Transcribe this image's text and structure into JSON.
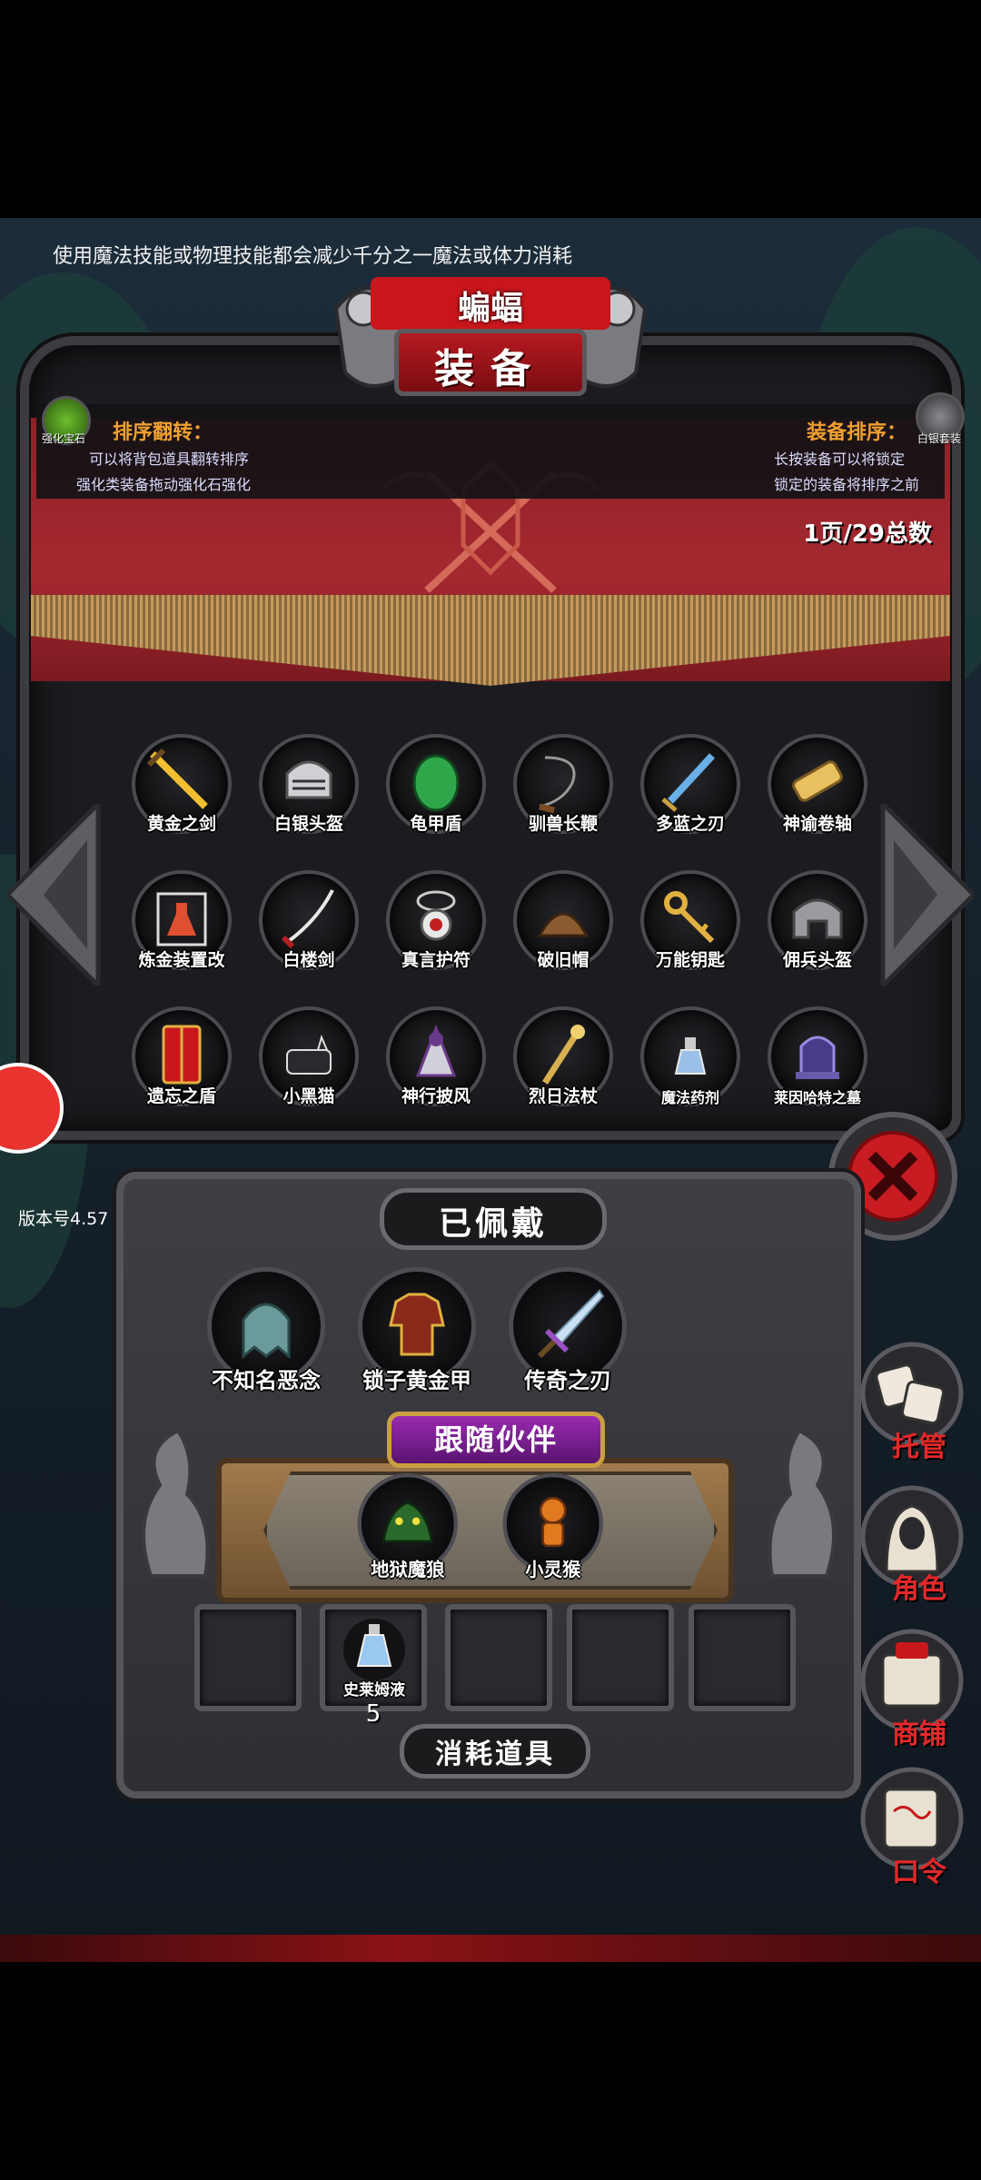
{
  "tip": "使用魔法技能或物理技能都会减少千分之一魔法或体力消耗",
  "header": {
    "nickname": "蝙蝠",
    "title": "装备"
  },
  "info": {
    "left_icon_label": "强化宝石",
    "left_title": "排序翻转：",
    "left_line1": "可以将背包道具翻转排序",
    "left_line2": "强化类装备拖动强化石强化",
    "right_icon_label": "白银套装",
    "right_title": "装备排序：",
    "right_line1": "长按装备可以将锁定",
    "right_line2": "锁定的装备将排序之前",
    "page_count": "1页/29总数"
  },
  "inventory": [
    {
      "label": "黄金之剑",
      "icon": "golden-sword-icon"
    },
    {
      "label": "白银头盔",
      "icon": "silver-helmet-icon"
    },
    {
      "label": "龟甲盾",
      "icon": "turtle-shield-icon"
    },
    {
      "label": "驯兽长鞭",
      "icon": "whip-icon"
    },
    {
      "label": "多蓝之刃",
      "icon": "blue-blade-icon"
    },
    {
      "label": "神谕卷轴",
      "icon": "scroll-icon"
    },
    {
      "label": "炼金装置改",
      "icon": "alchemy-flask-icon"
    },
    {
      "label": "白楼剑",
      "icon": "katana-icon"
    },
    {
      "label": "真言护符",
      "icon": "amulet-icon"
    },
    {
      "label": "破旧帽",
      "icon": "old-hat-icon"
    },
    {
      "label": "万能钥匙",
      "icon": "key-icon"
    },
    {
      "label": "佣兵头盔",
      "icon": "mercenary-helmet-icon"
    },
    {
      "label": "遗忘之盾",
      "icon": "red-shield-icon"
    },
    {
      "label": "小黑猫",
      "icon": "black-cat-icon"
    },
    {
      "label": "神行披风",
      "icon": "cloak-icon"
    },
    {
      "label": "烈日法杖",
      "icon": "staff-icon"
    },
    {
      "label": "魔法药剂",
      "icon": "potion-icon"
    },
    {
      "label": "莱因哈特之墓",
      "icon": "tomb-icon"
    }
  ],
  "version": "版本号4.57",
  "worn": {
    "title": "已佩戴",
    "items": [
      {
        "label": "不知名恶念",
        "icon": "ghost-icon"
      },
      {
        "label": "锁子黄金甲",
        "icon": "golden-armor-icon"
      },
      {
        "label": "传奇之刃",
        "icon": "legend-blade-icon"
      }
    ]
  },
  "companions": {
    "title": "跟随伙伴",
    "items": [
      {
        "label": "地狱魔狼",
        "icon": "hell-wolf-icon"
      },
      {
        "label": "小灵猴",
        "icon": "monkey-icon"
      }
    ]
  },
  "consumables": {
    "title": "消耗道具",
    "item_label": "史莱姆液",
    "item_count": "5"
  },
  "side_menu": {
    "auto": "托管",
    "role": "角色",
    "shop": "商铺",
    "code": "口令"
  },
  "colors": {
    "accent_orange": "#f0a030",
    "curtain_red": "#a52830",
    "side_label_red": "#e4282a",
    "companion_purple": "#9a2ab0"
  }
}
